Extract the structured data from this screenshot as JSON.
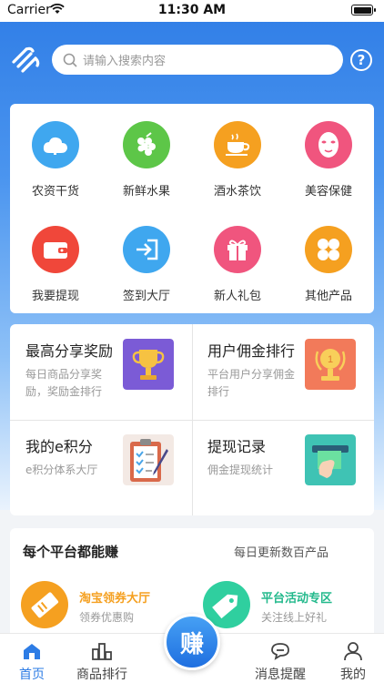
{
  "status": {
    "carrier": "Carrier",
    "time": "11:30 AM"
  },
  "search": {
    "placeholder": "请输入搜索内容"
  },
  "help": {
    "glyph": "?"
  },
  "categories": [
    {
      "label": "农资干货",
      "icon": "cloud-icon",
      "color": "#3fa7ef"
    },
    {
      "label": "新鲜水果",
      "icon": "grapes-icon",
      "color": "#5dc648"
    },
    {
      "label": "酒水茶饮",
      "icon": "teacup-icon",
      "color": "#f5a020"
    },
    {
      "label": "美容保健",
      "icon": "face-mask-icon",
      "color": "#f0557e"
    },
    {
      "label": "我要提现",
      "icon": "wallet-icon",
      "color": "#f0473a"
    },
    {
      "label": "签到大厅",
      "icon": "sign-in-icon",
      "color": "#3fa7ef"
    },
    {
      "label": "新人礼包",
      "icon": "gift-icon",
      "color": "#f0557e"
    },
    {
      "label": "其他产品",
      "icon": "grid-icon",
      "color": "#f5a020"
    }
  ],
  "features": [
    {
      "title": "最高分享奖励",
      "subtitle": "每日商品分享奖励，奖励金排行",
      "icon": "trophy-icon"
    },
    {
      "title": "用户佣金排行",
      "subtitle": "平台用户分享佣金排行",
      "icon": "medal-icon"
    },
    {
      "title": "我的e积分",
      "subtitle": "e积分体系大厅",
      "icon": "clipboard-icon"
    },
    {
      "title": "提现记录",
      "subtitle": "佣金提现统计",
      "icon": "atm-cash-icon"
    }
  ],
  "earn": {
    "heading": "每个平台都能赚",
    "subheading": "每日更新数百产品",
    "items": [
      {
        "title": "淘宝领券大厅",
        "subtitle": "领券优惠购",
        "color": "#f5a020"
      },
      {
        "title": "平台活动专区",
        "subtitle": "关注线上好礼",
        "color": "#2fcf9f"
      }
    ]
  },
  "tabbar": {
    "home": "首页",
    "ranking": "商品排行",
    "fab": "赚",
    "messages": "消息提醒",
    "mine": "我的"
  },
  "colors": {
    "accent": "#2d7ce5"
  }
}
